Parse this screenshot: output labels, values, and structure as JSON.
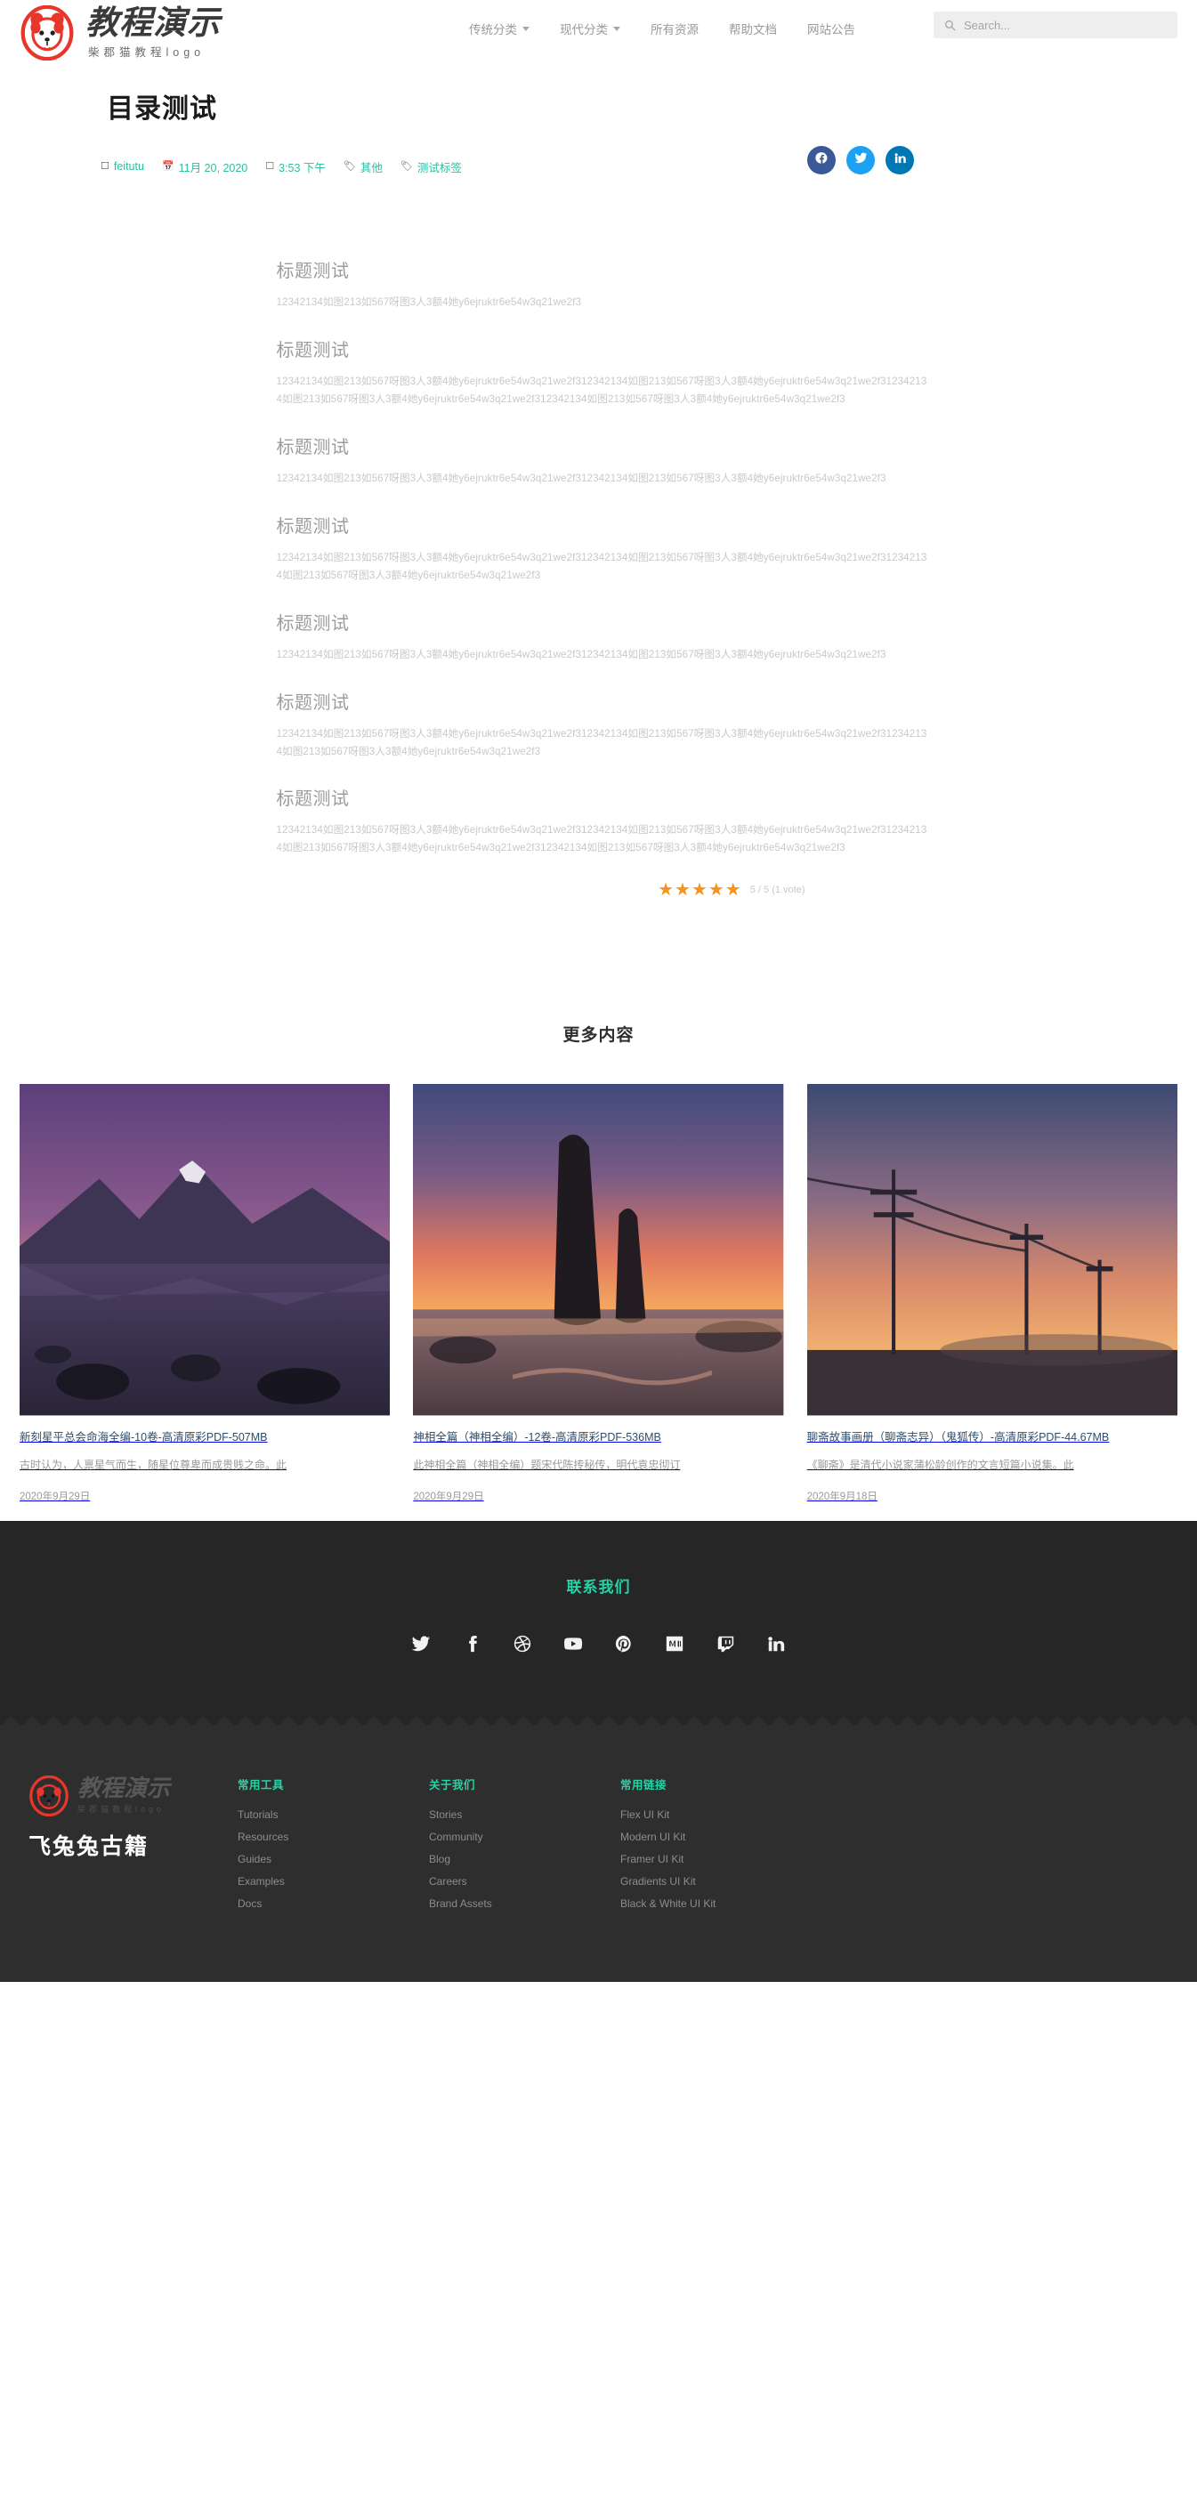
{
  "header": {
    "brand": {
      "title": "教程演示",
      "subtitle": "柴郡猫教程logo",
      "logo_icon": "dog-logo-icon"
    },
    "nav": [
      {
        "label": "传统分类",
        "has_caret": true
      },
      {
        "label": "现代分类",
        "has_caret": true
      },
      {
        "label": "所有资源",
        "has_caret": false
      },
      {
        "label": "帮助文档",
        "has_caret": false
      },
      {
        "label": "网站公告",
        "has_caret": false
      }
    ],
    "search": {
      "placeholder": "Search...",
      "value": "",
      "icon": "search-icon"
    }
  },
  "post": {
    "title": "目录测试",
    "meta": {
      "author": "feitutu",
      "date": "11月 20, 2020",
      "time": "3:53 下午",
      "category": "其他",
      "tag": "测试标签",
      "accent_color": "#2bbfa0"
    },
    "share": [
      {
        "name": "facebook",
        "color": "#3b5998"
      },
      {
        "name": "twitter",
        "color": "#1da1f2"
      },
      {
        "name": "linkedin",
        "color": "#0077b5"
      }
    ],
    "sections": [
      {
        "heading": "标题测试",
        "body": "12342134如图213如567呀图3人3额4她y6ejruktr6e54w3q21we2f3"
      },
      {
        "heading": "标题测试",
        "body": "12342134如图213如567呀图3人3额4她y6ejruktr6e54w3q21we2f312342134如图213如567呀图3人3额4她y6ejruktr6e54w3q21we2f312342134如图213如567呀图3人3额4她y6ejruktr6e54w3q21we2f312342134如图213如567呀图3人3额4她y6ejruktr6e54w3q21we2f3"
      },
      {
        "heading": "标题测试",
        "body": "12342134如图213如567呀图3人3额4她y6ejruktr6e54w3q21we2f312342134如图213如567呀图3人3额4她y6ejruktr6e54w3q21we2f3"
      },
      {
        "heading": "标题测试",
        "body": "12342134如图213如567呀图3人3额4她y6ejruktr6e54w3q21we2f312342134如图213如567呀图3人3额4她y6ejruktr6e54w3q21we2f312342134如图213如567呀图3人3额4她y6ejruktr6e54w3q21we2f3"
      },
      {
        "heading": "标题测试",
        "body": "12342134如图213如567呀图3人3额4她y6ejruktr6e54w3q21we2f312342134如图213如567呀图3人3额4她y6ejruktr6e54w3q21we2f3"
      },
      {
        "heading": "标题测试",
        "body": "12342134如图213如567呀图3人3额4她y6ejruktr6e54w3q21we2f312342134如图213如567呀图3人3额4她y6ejruktr6e54w3q21we2f312342134如图213如567呀图3人3额4她y6ejruktr6e54w3q21we2f3"
      },
      {
        "heading": "标题测试",
        "body": "12342134如图213如567呀图3人3额4她y6ejruktr6e54w3q21we2f312342134如图213如567呀图3人3额4她y6ejruktr6e54w3q21we2f312342134如图213如567呀图3人3额4她y6ejruktr6e54w3q21we2f312342134如图213如567呀图3人3额4她y6ejruktr6e54w3q21we2f3"
      }
    ],
    "rating": {
      "stars": "★★★★★",
      "score_text": "5 / 5 (1 vote)",
      "star_color": "#f7941d"
    }
  },
  "more": {
    "title": "更多内容",
    "cards": [
      {
        "thumb": "mountain-lake-sunset-photo",
        "title": "新刻星平总会命海全编-10卷-高清原彩PDF-507MB",
        "excerpt": "古时认为，人禀星气而生，随星位尊卑而成贵贱之命。此",
        "date": "2020年9月29日"
      },
      {
        "thumb": "sea-stack-rock-sunset-photo",
        "title": "神相全篇（神相全编）-12卷-高清原彩PDF-536MB",
        "excerpt": "此神相全篇（神相全编）题宋代陈抟秘传，明代袁忠彻订",
        "date": "2020年9月29日"
      },
      {
        "thumb": "power-lines-dusk-photo",
        "title": "聊斋故事画册（聊斋志异）（鬼狐传）-高清原彩PDF-44.67MB",
        "excerpt": "《聊斋》是清代小说家蒲松龄创作的文言短篇小说集。此",
        "date": "2020年9月18日"
      }
    ]
  },
  "footer": {
    "contact_title": "联系我们",
    "accent_color": "#25d3a6",
    "social": [
      "twitter-icon",
      "facebook-icon",
      "dribbble-icon",
      "youtube-icon",
      "pinterest-icon",
      "medium-icon",
      "twitch-icon",
      "linkedin-icon"
    ],
    "brand": {
      "title": "教程演示",
      "subtitle": "柴郡猫教程logo",
      "site_name": "飞兔兔古籍"
    },
    "columns": [
      {
        "title": "常用工具",
        "links": [
          "Tutorials",
          "Resources",
          "Guides",
          "Examples",
          "Docs"
        ]
      },
      {
        "title": "关于我们",
        "links": [
          "Stories",
          "Community",
          "Blog",
          "Careers",
          "Brand Assets"
        ]
      },
      {
        "title": "常用链接",
        "links": [
          "Flex UI Kit",
          "Modern UI Kit",
          "Framer UI Kit",
          "Gradients UI Kit",
          "Black & White UI Kit"
        ]
      }
    ]
  }
}
